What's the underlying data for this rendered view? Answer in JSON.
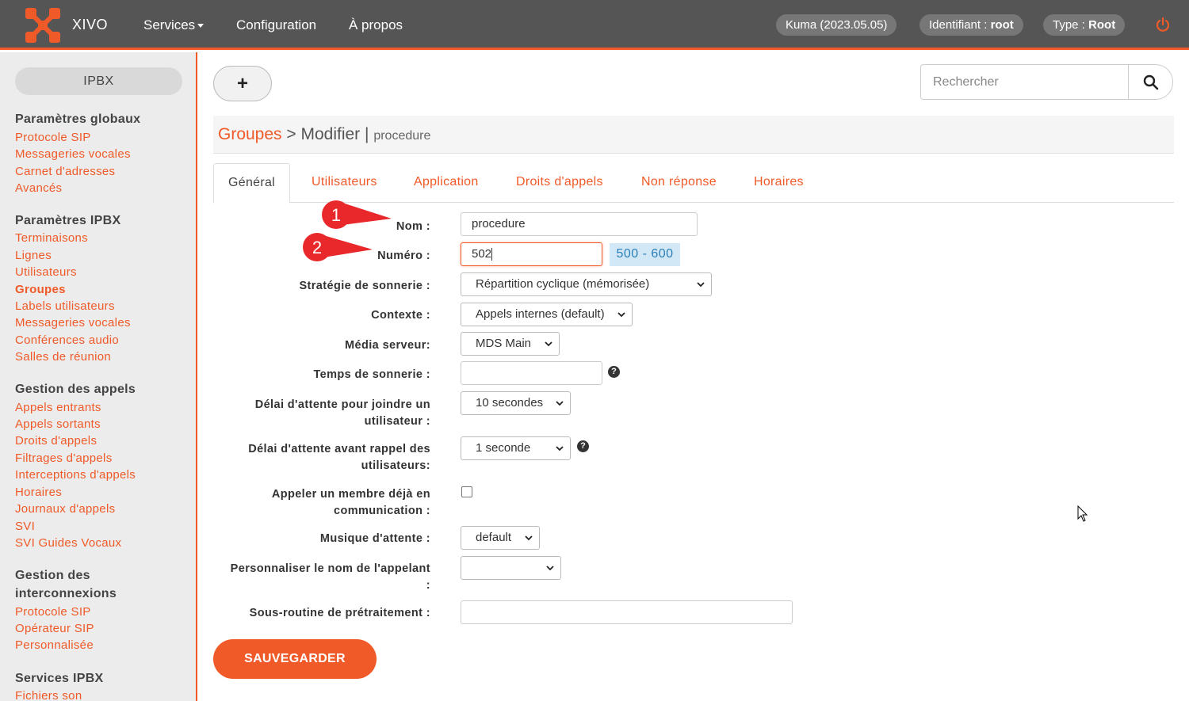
{
  "topbar": {
    "brand": "XIVO",
    "nav": [
      "Services",
      "Configuration",
      "À propos"
    ],
    "version": "Kuma (2023.05.05)",
    "login_label": "Identifiant : ",
    "login_value": "root",
    "type_label": "Type : ",
    "type_value": "Root",
    "accent_color": "#f05a28",
    "power_icon": "power-icon"
  },
  "sidebar": {
    "section_pill": "IPBX",
    "groups": [
      {
        "title": "Paramètres globaux",
        "items": [
          "Protocole SIP",
          "Messageries vocales",
          "Carnet d'adresses",
          "Avancés"
        ]
      },
      {
        "title": "Paramètres IPBX",
        "items": [
          "Terminaisons",
          "Lignes",
          "Utilisateurs",
          "Groupes",
          "Labels utilisateurs",
          "Messageries vocales",
          "Conférences audio",
          "Salles de réunion"
        ]
      },
      {
        "title": "Gestion des appels",
        "items": [
          "Appels entrants",
          "Appels sortants",
          "Droits d'appels",
          "Filtrages d'appels",
          "Interceptions d'appels",
          "Horaires",
          "Journaux d'appels",
          "SVI",
          "SVI Guides Vocaux"
        ]
      },
      {
        "title_line1": "Gestion des",
        "title_line2": "interconnexions",
        "items": [
          "Protocole SIP",
          "Opérateur SIP",
          "Personnalisée"
        ]
      },
      {
        "title": "Services IPBX",
        "items": [
          "Fichiers son"
        ]
      }
    ]
  },
  "toolbar": {
    "add_label": "+",
    "search_placeholder": "Rechercher"
  },
  "breadcrumb": {
    "link": "Groupes",
    "separator": " > ",
    "current": "Modifier",
    "pipe": " | ",
    "entity": "procedure"
  },
  "tabs": [
    "Général",
    "Utilisateurs",
    "Application",
    "Droits d'appels",
    "Non réponse",
    "Horaires"
  ],
  "form": {
    "nom_label": "Nom :",
    "nom_value": "procedure",
    "numero_label": "Numéro :",
    "numero_value": "502",
    "numero_range": "500 - 600",
    "strategie_label": "Stratégie de sonnerie :",
    "strategie_value": "Répartition cyclique (mémorisée)",
    "contexte_label": "Contexte :",
    "contexte_value": "Appels internes (default)",
    "media_label": "Média serveur:",
    "media_value": "MDS Main",
    "temps_label": "Temps de sonnerie :",
    "temps_value": "",
    "delai_joindre_line1": "Délai d'attente pour joindre un",
    "delai_joindre_line2": "utilisateur :",
    "delai_joindre_value": "10 secondes",
    "delai_rappel_line1": "Délai d'attente avant rappel des",
    "delai_rappel_line2": "utilisateurs:",
    "delai_rappel_value": "1 seconde",
    "appeler_line1": "Appeler un membre déjà en",
    "appeler_line2": "communication :",
    "appeler_checked": false,
    "musique_label": "Musique d'attente :",
    "musique_value": "default",
    "perso_line1": "Personnaliser le nom de l'appelant",
    "perso_line2": ":",
    "perso_value": "",
    "sousroutine_label": "Sous-routine de prétraitement :",
    "sousroutine_value": "",
    "help_glyph": "?"
  },
  "save_label": "SAUVEGARDER",
  "annotations": {
    "first": "1",
    "second": "2",
    "marker_color": "#e8282a"
  }
}
